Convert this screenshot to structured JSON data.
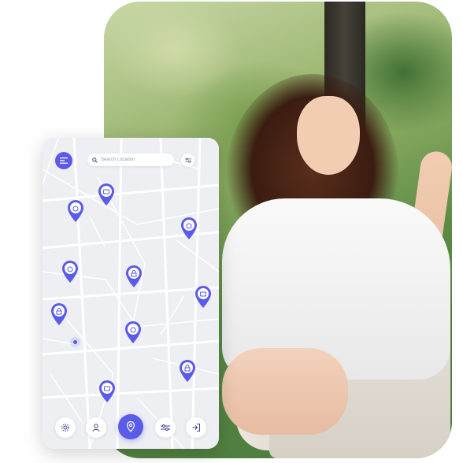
{
  "photo": {
    "description_icon": "woman-listening-music-photo"
  },
  "phone": {
    "header": {
      "menu_icon": "menu-icon",
      "search_placeholder": "Search Location",
      "search_icon": "search-icon",
      "filter_icon": "sliders-icon"
    },
    "pins": [
      {
        "icon": "briefcase-icon"
      },
      {
        "icon": "bag-icon"
      },
      {
        "icon": "bag-icon"
      },
      {
        "icon": "bag-icon"
      },
      {
        "icon": "lock-icon"
      },
      {
        "icon": "briefcase-icon"
      },
      {
        "icon": "lock-icon"
      },
      {
        "icon": "bag-icon"
      },
      {
        "icon": "lock-icon"
      },
      {
        "icon": "briefcase-icon"
      }
    ],
    "nav": [
      {
        "icon": "gear-icon"
      },
      {
        "icon": "user-icon"
      },
      {
        "icon": "location-pin-icon"
      },
      {
        "icon": "sliders-icon"
      },
      {
        "icon": "logout-icon"
      }
    ]
  },
  "colors": {
    "accent": "#5a5be8",
    "map_bg": "#f1f2f5",
    "road": "#ffffff"
  }
}
